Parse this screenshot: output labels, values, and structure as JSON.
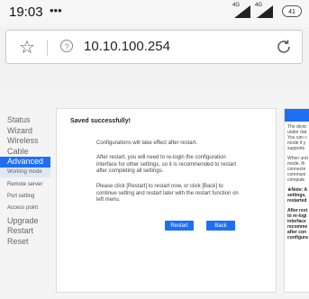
{
  "status_bar": {
    "time": "19:03",
    "dots": "•••",
    "signal_1": "4G",
    "signal_2": "4G",
    "battery": "41"
  },
  "browser": {
    "url": "10.10.100.254"
  },
  "sidebar": {
    "items": [
      {
        "label": "Status"
      },
      {
        "label": "Wizard"
      },
      {
        "label": "Wireless"
      },
      {
        "label": "Cable"
      },
      {
        "label": "Advanced"
      }
    ],
    "sub_items": [
      {
        "label": "Working mode"
      },
      {
        "label": "Remote server"
      },
      {
        "label": "Port setting"
      },
      {
        "label": "Access point"
      }
    ],
    "bottom_items": [
      {
        "label": "Upgrade"
      },
      {
        "label": "Restart"
      },
      {
        "label": "Reset"
      }
    ]
  },
  "main": {
    "title": "Saved successfully!",
    "line1": "Configurations will take effect after restart.",
    "para2": [
      "After restart, you will need to re-login the configuration",
      "interface for other settings, so it is recommended to restart",
      "after completing all settings."
    ],
    "para3": [
      "Please click [Restart] to restart now, or click [Back] to",
      "continue setting and restart later with the restart function on",
      "left menu."
    ],
    "restart_label": "Restart",
    "back_label": "Back"
  },
  "help": {
    "lines_a": [
      "The devic",
      "under dat",
      "You can c",
      "mode if y",
      "supports"
    ],
    "lines_b": [
      "When und",
      "mode, th",
      "connecte",
      "communi",
      "compute"
    ],
    "note": [
      "★Note: A",
      "settings,",
      "restarted"
    ],
    "after": [
      "After rest",
      "to re-logi",
      "interface",
      "recomme",
      "after con",
      "configura"
    ]
  },
  "colors": {
    "accent": "#1f6ff5",
    "background": "#f4f4f4"
  }
}
